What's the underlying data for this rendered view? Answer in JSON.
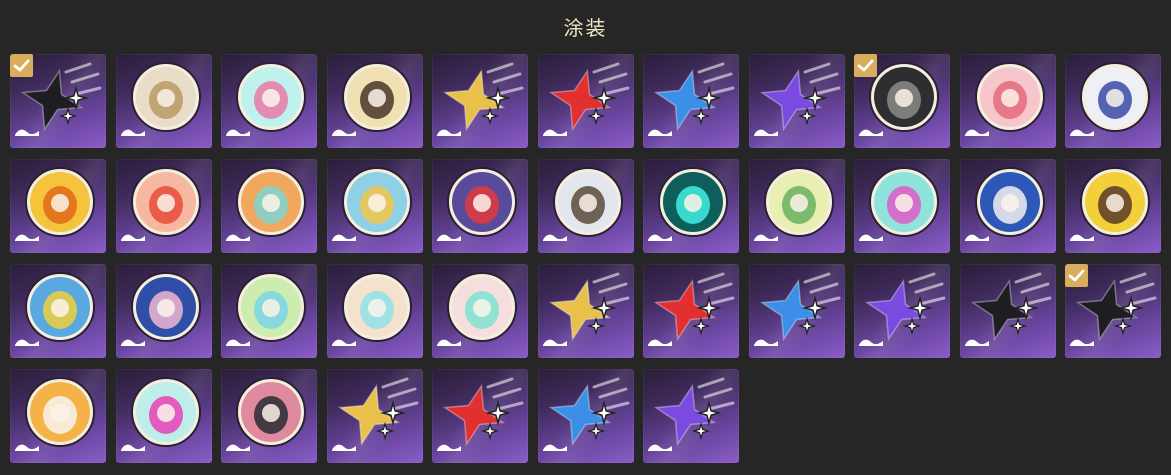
{
  "header": {
    "title": "涂装"
  },
  "colors": {
    "gold": "#e8c04a",
    "red": "#e23030",
    "blue": "#3b8fe6",
    "purple": "#7b4ae0",
    "black": "#1e1e22",
    "check": "#d9ad5c"
  },
  "items": [
    {
      "kind": "star",
      "color": "black",
      "checked": true
    },
    {
      "kind": "avatar",
      "icon": "white-creature-avatar-icon",
      "bg": "#e9dcc8",
      "fg": "#b89a62",
      "checked": false
    },
    {
      "kind": "avatar",
      "icon": "aqua-wave-emblem-icon",
      "bg": "#bff2ec",
      "fg": "#e87aa8",
      "checked": false
    },
    {
      "kind": "avatar",
      "icon": "dark-hair-girl-avatar-icon",
      "bg": "#f0e0b2",
      "fg": "#4a3528",
      "checked": false
    },
    {
      "kind": "star",
      "color": "gold",
      "checked": false
    },
    {
      "kind": "star",
      "color": "red",
      "checked": false
    },
    {
      "kind": "star",
      "color": "blue",
      "checked": false
    },
    {
      "kind": "star",
      "color": "purple",
      "checked": false
    },
    {
      "kind": "avatar",
      "icon": "dark-armored-figure-icon",
      "bg": "#2e2e30",
      "fg": "#8a8a86",
      "checked": true
    },
    {
      "kind": "avatar",
      "icon": "pink-hair-character-icon",
      "bg": "#f6c6cc",
      "fg": "#e46a7a",
      "checked": false
    },
    {
      "kind": "avatar",
      "icon": "blue-crest-emblem-icon",
      "bg": "#eef0f6",
      "fg": "#3a4aa8",
      "checked": false
    },
    {
      "kind": "avatar",
      "icon": "orange-hair-boy-avatar-icon",
      "bg": "#f5c33c",
      "fg": "#e06a18",
      "checked": false
    },
    {
      "kind": "avatar",
      "icon": "colorful-shop-stall-icon",
      "bg": "#f6b8a0",
      "fg": "#e84a3a",
      "checked": false
    },
    {
      "kind": "avatar",
      "icon": "teal-robot-mask-icon",
      "bg": "#f1a85e",
      "fg": "#7fd6d0",
      "checked": false
    },
    {
      "kind": "avatar",
      "icon": "blonde-boy-avatar-icon",
      "bg": "#8ed0e6",
      "fg": "#f2c64a",
      "checked": false
    },
    {
      "kind": "avatar",
      "icon": "red-blue-swirl-icon",
      "bg": "#5a4a9a",
      "fg": "#e23a3a",
      "checked": false
    },
    {
      "kind": "avatar",
      "icon": "white-orb-eye-icon",
      "bg": "#e4e6ee",
      "fg": "#5a4a3a",
      "checked": false
    },
    {
      "kind": "avatar",
      "icon": "teal-cube-logo-icon",
      "bg": "#0e5e5c",
      "fg": "#3ff0e0",
      "checked": false
    },
    {
      "kind": "avatar",
      "icon": "white-cat-girl-icon",
      "bg": "#e8efb0",
      "fg": "#6ab060",
      "checked": false
    },
    {
      "kind": "avatar",
      "icon": "aqua-tea-cup-icon",
      "bg": "#8ee4dc",
      "fg": "#e05ac8",
      "checked": false
    },
    {
      "kind": "avatar",
      "icon": "penguin-bird-icon",
      "bg": "#2e58b8",
      "fg": "#f0f0f0",
      "checked": false
    },
    {
      "kind": "avatar",
      "icon": "cow-bunny-mascot-icon",
      "bg": "#f3cf3a",
      "fg": "#5a3a2a",
      "checked": false
    },
    {
      "kind": "avatar",
      "icon": "yellow-tank-island-icon",
      "bg": "#5aa8e0",
      "fg": "#f0d040",
      "checked": false
    },
    {
      "kind": "avatar",
      "icon": "pink-hair-girl-icon",
      "bg": "#2f4ea8",
      "fg": "#f0b6d2",
      "checked": false
    },
    {
      "kind": "avatar",
      "icon": "sleeping-blob-icon",
      "bg": "#cdecb0",
      "fg": "#7ad6e6",
      "checked": false
    },
    {
      "kind": "avatar",
      "icon": "ghost-bunny-icon",
      "bg": "#f4e2cc",
      "fg": "#8ee2ea",
      "checked": false
    },
    {
      "kind": "avatar",
      "icon": "mint-bunny-icon",
      "bg": "#f6dede",
      "fg": "#7ee4d0",
      "checked": false
    },
    {
      "kind": "star",
      "color": "gold",
      "checked": false
    },
    {
      "kind": "star",
      "color": "red",
      "checked": false
    },
    {
      "kind": "star",
      "color": "blue",
      "checked": false
    },
    {
      "kind": "star",
      "color": "purple",
      "checked": false
    },
    {
      "kind": "star",
      "color": "black",
      "checked": false
    },
    {
      "kind": "star",
      "color": "black",
      "checked": true
    },
    {
      "kind": "avatar",
      "icon": "white-dog-mascot-icon",
      "bg": "#f4b248",
      "fg": "#f8f4ee",
      "checked": false
    },
    {
      "kind": "avatar",
      "icon": "pink-cat-face-icon",
      "bg": "#bfeeea",
      "fg": "#e842b8",
      "checked": false
    },
    {
      "kind": "avatar",
      "icon": "dark-hair-boy-icon",
      "bg": "#e08aa0",
      "fg": "#2a2a30",
      "checked": false
    },
    {
      "kind": "star",
      "color": "gold",
      "checked": false
    },
    {
      "kind": "star",
      "color": "red",
      "checked": false
    },
    {
      "kind": "star",
      "color": "blue",
      "checked": false
    },
    {
      "kind": "star",
      "color": "purple",
      "checked": false
    }
  ]
}
